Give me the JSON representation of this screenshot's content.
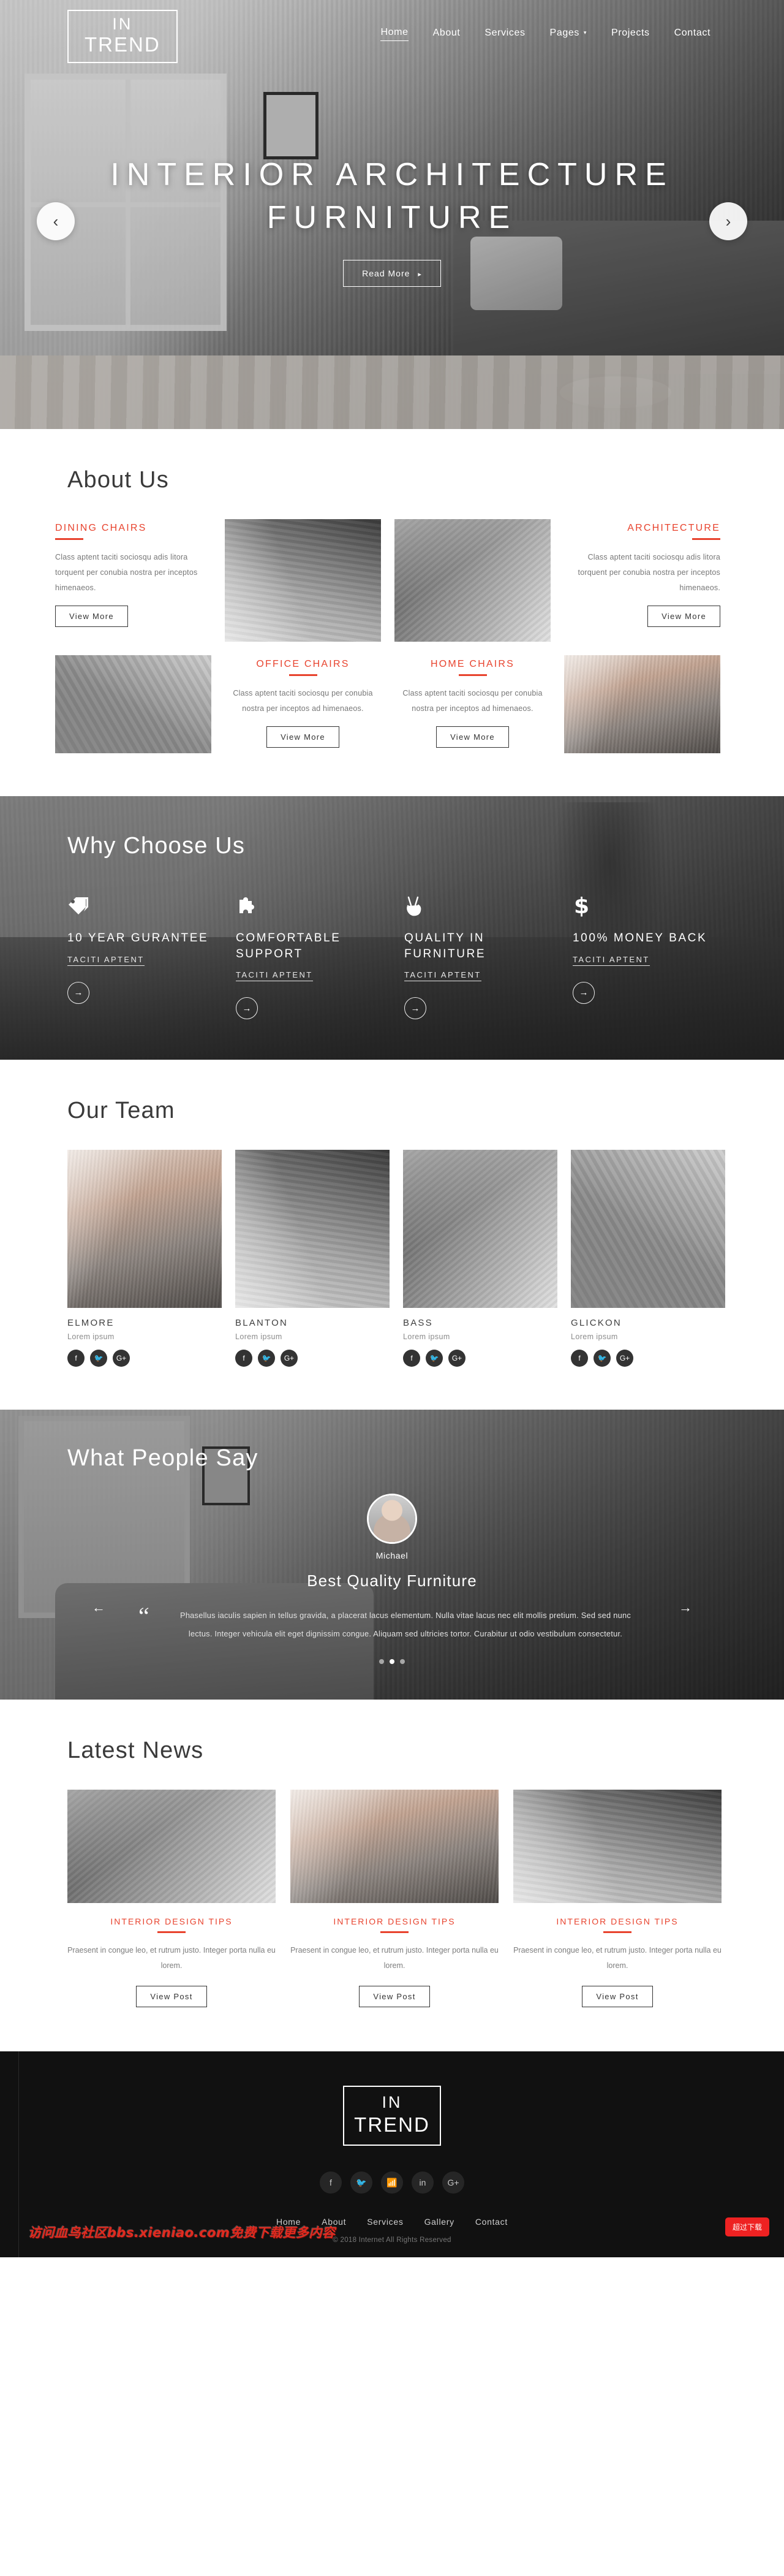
{
  "brand": {
    "line1": "IN",
    "line2": "TREND"
  },
  "nav": {
    "items": [
      {
        "label": "Home",
        "active": true
      },
      {
        "label": "About",
        "active": false
      },
      {
        "label": "Services",
        "active": false
      },
      {
        "label": "Pages",
        "active": false,
        "caret": "▾"
      },
      {
        "label": "Projects",
        "active": false
      },
      {
        "label": "Contact",
        "active": false
      }
    ]
  },
  "hero": {
    "line1": "INTERIOR ARCHITECTURE",
    "line2": "FURNITURE",
    "cta": "Read More",
    "cta_arrow": "▸",
    "prev": "‹",
    "next": "›"
  },
  "about": {
    "title": "About Us",
    "cards": [
      {
        "heading": "DINING CHAIRS",
        "body": "Class aptent taciti sociosqu adis litora torquent per conubia nostra per inceptos himenaeos.",
        "button": "View More"
      },
      {
        "heading": "ARCHITECTURE",
        "body": "Class aptent taciti sociosqu adis litora torquent per conubia nostra per inceptos himenaeos.",
        "button": "View More"
      },
      {
        "heading": "OFFICE CHAIRS",
        "body": "Class aptent taciti sociosqu per conubia nostra per inceptos ad himenaeos.",
        "button": "View More"
      },
      {
        "heading": "HOME CHAIRS",
        "body": "Class aptent taciti sociosqu per conubia nostra per inceptos ad himenaeos.",
        "button": "View More"
      }
    ]
  },
  "why": {
    "title": "Why Choose Us",
    "features": [
      {
        "icon": "tag-icon",
        "heading": "10 YEAR GURANTEE",
        "link": "TACITI APTENT",
        "arrow": "→"
      },
      {
        "icon": "puzzle-icon",
        "heading": "COMFORTABLE SUPPORT",
        "link": "TACITI APTENT",
        "arrow": "→"
      },
      {
        "icon": "peace-hand-icon",
        "heading": "QUALITY IN FURNITURE",
        "link": "TACITI APTENT",
        "arrow": "→"
      },
      {
        "icon": "dollar-icon",
        "heading": "100% MONEY BACK",
        "link": "TACITI APTENT",
        "arrow": "→"
      }
    ]
  },
  "team": {
    "title": "Our Team",
    "members": [
      {
        "name": "ELMORE",
        "role": "Lorem ipsum"
      },
      {
        "name": "BLANTON",
        "role": "Lorem ipsum"
      },
      {
        "name": "BASS",
        "role": "Lorem ipsum"
      },
      {
        "name": "GLICKON",
        "role": "Lorem ipsum"
      }
    ],
    "socials": [
      "facebook-icon",
      "twitter-icon",
      "google-plus-icon"
    ]
  },
  "testimonial": {
    "title": "What People Say",
    "author": "Michael",
    "headline": "Best Quality Furniture",
    "quote": "Phasellus iaculis sapien in tellus gravida, a placerat lacus elementum. Nulla vitae lacus nec elit mollis pretium. Sed sed nunc lectus. Integer vehicula elit eget dignissim congue. Aliquam sed ultricies tortor. Curabitur ut odio vestibulum consectetur.",
    "quote_mark": "“",
    "prev": "←",
    "next": "→",
    "dots": 3,
    "active_dot": 1
  },
  "news": {
    "title": "Latest News",
    "posts": [
      {
        "category": "INTERIOR DESIGN TIPS",
        "excerpt": "Praesent in congue leo, et rutrum justo. Integer porta nulla eu lorem.",
        "button": "View Post"
      },
      {
        "category": "INTERIOR DESIGN TIPS",
        "excerpt": "Praesent in congue leo, et rutrum justo. Integer porta nulla eu lorem.",
        "button": "View Post"
      },
      {
        "category": "INTERIOR DESIGN TIPS",
        "excerpt": "Praesent in congue leo, et rutrum justo. Integer porta nulla eu lorem.",
        "button": "View Post"
      }
    ]
  },
  "footer": {
    "socials": [
      "facebook-icon",
      "twitter-icon",
      "rss-icon",
      "linkedin-icon",
      "google-plus-icon"
    ],
    "nav": [
      "Home",
      "About",
      "Services",
      "Gallery",
      "Contact"
    ],
    "copyright": "© 2018 Internet All Rights Reserved"
  },
  "overlay": {
    "watermark": "访问血鸟社区bbs.xieniao.com免费下载更多内容",
    "download_badge": "超过下载"
  },
  "colors": {
    "accent": "#e8432e",
    "dark": "#111111",
    "text": "#4a4a4a"
  }
}
